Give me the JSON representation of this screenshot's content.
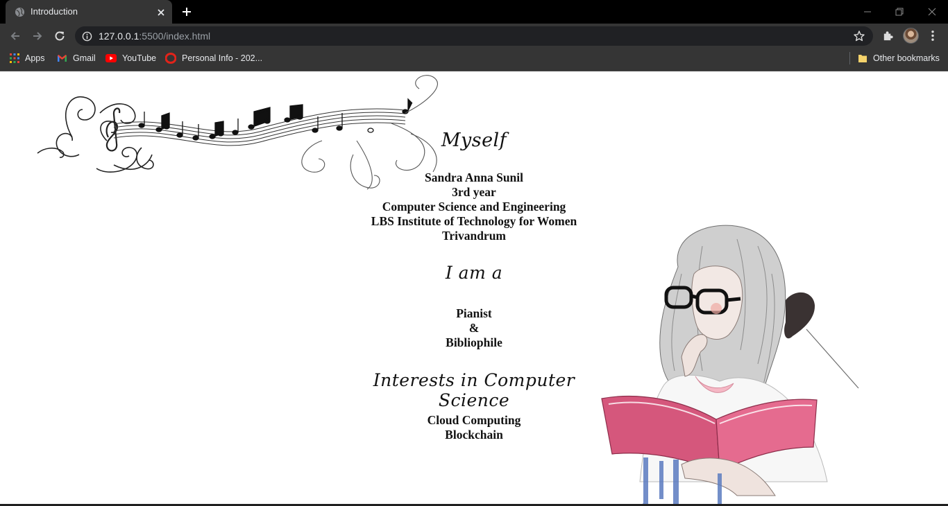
{
  "browser": {
    "tab": {
      "title": "Introduction"
    },
    "address_bar": {
      "url_host": "127.0.0.1",
      "url_rest": ":5500/index.html"
    },
    "bookmarks": [
      {
        "label": "Apps",
        "icon": "apps-grid-icon"
      },
      {
        "label": "Gmail",
        "icon": "gmail-icon"
      },
      {
        "label": "YouTube",
        "icon": "youtube-icon"
      },
      {
        "label": "Personal Info - 202...",
        "icon": "opera-o-icon"
      }
    ],
    "other_bookmarks": "Other bookmarks",
    "colors": {
      "chrome_dark": "#353535",
      "tabstrip": "#000000",
      "omnibox": "#202124",
      "text": "#e8eaed"
    }
  },
  "page": {
    "sections": [
      {
        "heading": "Myself",
        "lines": [
          "Sandra Anna Sunil",
          "3rd year",
          "Computer Science and Engineering",
          "LBS Institute of Technology for Women",
          "Trivandrum"
        ]
      },
      {
        "heading": "I am a",
        "lines": [
          "Pianist",
          "&",
          "Bibliophile"
        ]
      },
      {
        "heading": "Interests in Computer Science",
        "lines": [
          "Cloud Computing",
          "Blockchain"
        ]
      }
    ],
    "images": {
      "top_left": "music-notes-staff-illustration",
      "right": "girl-reading-book-sketch"
    }
  }
}
